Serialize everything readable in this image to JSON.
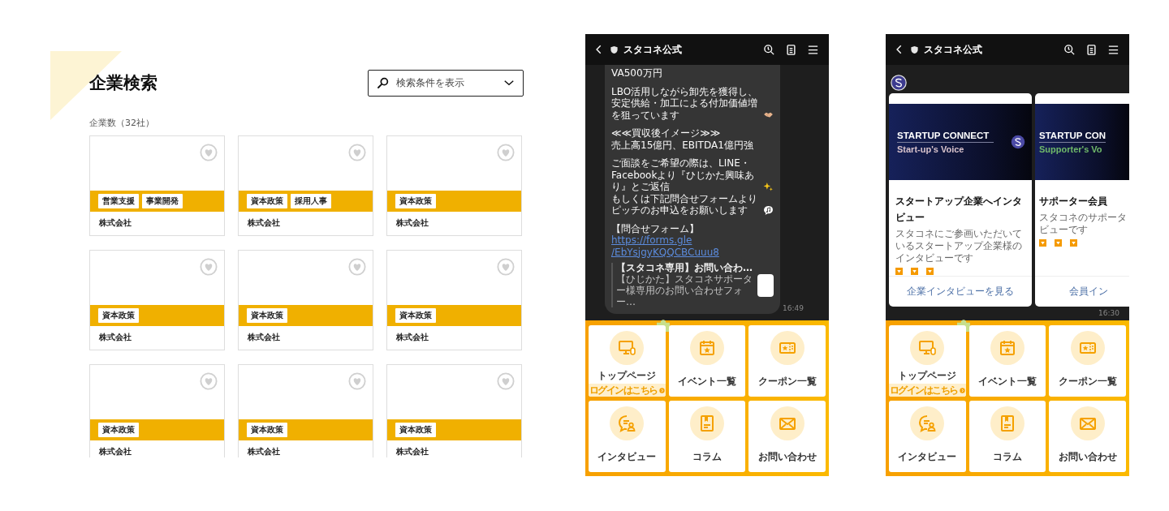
{
  "search_page": {
    "title": "企業検索",
    "search_toggle": {
      "label": "検索条件を表示"
    },
    "count": "企業数（32社）",
    "companies": [
      {
        "tags": [
          "営業支援",
          "事業開発"
        ],
        "name": "株式会社",
        "favorite": false
      },
      {
        "tags": [
          "資本政策",
          "採用人事"
        ],
        "name": "株式会社",
        "favorite": false
      },
      {
        "tags": [
          "資本政策"
        ],
        "name": "株式会社",
        "favorite": false
      },
      {
        "tags": [
          "資本政策"
        ],
        "name": "株式会社",
        "favorite": false
      },
      {
        "tags": [
          "資本政策"
        ],
        "name": "株式会社",
        "favorite": false
      },
      {
        "tags": [
          "資本政策"
        ],
        "name": "株式会社",
        "favorite": false
      },
      {
        "tags": [
          "資本政策"
        ],
        "name": "株式会社",
        "favorite": false
      },
      {
        "tags": [
          "資本政策"
        ],
        "name": "株式会社",
        "favorite": false
      },
      {
        "tags": [
          "資本政策"
        ],
        "name": "株式会社",
        "favorite": false
      }
    ]
  },
  "phones": [
    {
      "kind": "message",
      "title": "スタコネ公式",
      "time": "16:49",
      "message": {
        "blocks": [
          [
            {
              "kind": "plain",
              "text": "VA500万円"
            }
          ],
          [
            {
              "kind": "handshake",
              "text": "LBO活用しながら卸先を獲得し、安定供給・加工による付加価値増を狙っています"
            }
          ],
          [
            {
              "kind": "plain",
              "text": "≪≪買収後イメージ≫≫"
            },
            {
              "kind": "plain",
              "text": "売上高15億円、EBITDA1億円強"
            }
          ],
          [
            {
              "kind": "sparkle",
              "text": "ご面談をご希望の際は、LINE・Facebookより『ひじかた興味あり』とご返信"
            },
            {
              "kind": "note",
              "text": "もしくは下記問合せフォームよりピッチのお申込をお願いします"
            }
          ],
          [
            {
              "kind": "plain",
              "text": "【問合せフォーム】"
            },
            {
              "kind": "link",
              "text": "https://forms.gle"
            },
            {
              "kind": "link",
              "text": "/EbYsjgyKQQCBCuuu8"
            }
          ]
        ],
        "preview": {
          "title": "【スタコネ専用】お問い合わ…",
          "description": "【ひじかた】スタコネサポーター様専用のお問い合わせフォー…"
        }
      },
      "menu": [
        {
          "label": "トップページ",
          "sublabel": "ログインはこちら"
        },
        {
          "label": "イベント一覧"
        },
        {
          "label": "クーポン一覧"
        },
        {
          "label": "インタビュー"
        },
        {
          "label": "コラム"
        },
        {
          "label": "お問い合わせ"
        }
      ]
    },
    {
      "kind": "carousel",
      "title": "スタコネ公式",
      "time": "16:30",
      "cards": [
        {
          "banner_title": "STARTUP CONNECT",
          "banner_subtitle": "Start-up's Voice",
          "color": "#d8c3cc",
          "logo": true,
          "title": "スタートアップ企業へインタビュー",
          "description": [
            "スタコネにご参画いただいているスタートアップ企業様のインタビューです"
          ],
          "link": "企業インタビューを見る"
        },
        {
          "banner_title": "STARTUP CON",
          "banner_subtitle": "Supporter's Vo",
          "color": "#6fb86a",
          "logo": false,
          "title": "サポーター会員",
          "description": [
            "スタコネのサポータ",
            "ビューです"
          ],
          "link": "会員イン"
        }
      ],
      "menu": [
        {
          "label": "トップページ",
          "sublabel": "ログインはこちら"
        },
        {
          "label": "イベント一覧"
        },
        {
          "label": "クーポン一覧"
        },
        {
          "label": "インタビュー"
        },
        {
          "label": "コラム"
        },
        {
          "label": "お問い合わせ"
        }
      ]
    }
  ]
}
